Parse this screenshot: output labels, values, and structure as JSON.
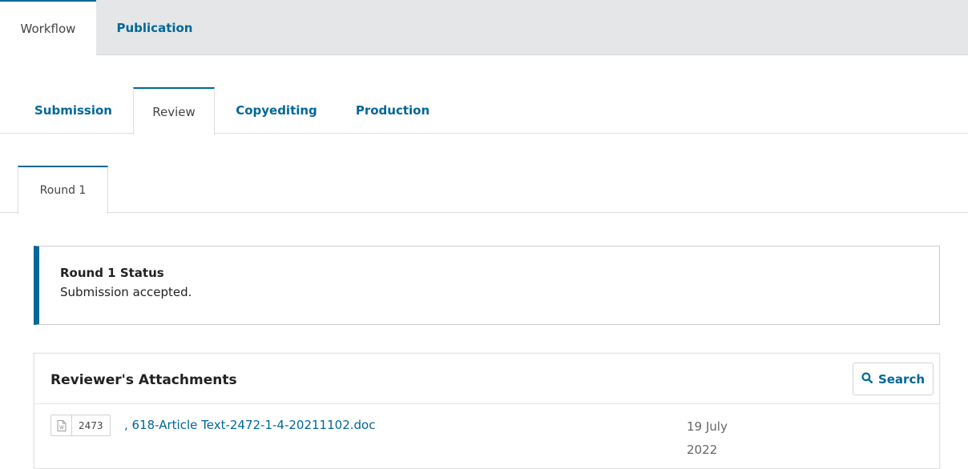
{
  "top_tabs": {
    "workflow": "Workflow",
    "publication": "Publication"
  },
  "stage_tabs": {
    "submission": "Submission",
    "review": "Review",
    "copyediting": "Copyediting",
    "production": "Production"
  },
  "round_tabs": {
    "round1": "Round 1"
  },
  "status": {
    "title": "Round 1 Status",
    "text": "Submission accepted."
  },
  "attachments": {
    "title": "Reviewer's Attachments",
    "search_label": "Search",
    "files": [
      {
        "id": "2473",
        "name": ", 618-Article Text-2472-1-4-20211102.doc",
        "date": "19 July 2022"
      }
    ]
  },
  "colors": {
    "accent": "#006798",
    "tab_bar_bg": "#e4e6e7"
  },
  "icons": {
    "search": "search-icon",
    "file": "document-icon"
  }
}
